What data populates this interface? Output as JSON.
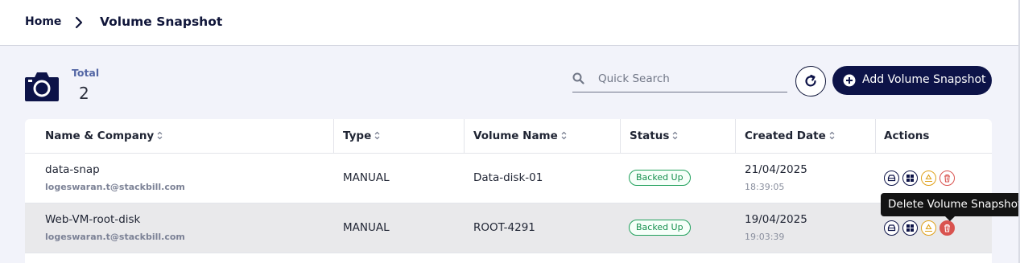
{
  "breadcrumb": {
    "home": "Home",
    "current": "Volume Snapshot"
  },
  "summary": {
    "label": "Total",
    "value": "2"
  },
  "search": {
    "placeholder": "Quick Search"
  },
  "actions": {
    "add_label": "Add Volume Snapshot"
  },
  "table": {
    "headers": [
      "Name & Company",
      "Type",
      "Volume Name",
      "Status",
      "Created Date",
      "Actions"
    ],
    "rows": [
      {
        "name": "data-snap",
        "email": "logeswaran.t@stackbill.com",
        "type": "MANUAL",
        "volume": "Data-disk-01",
        "status": "Backed Up",
        "date": "21/04/2025",
        "time": "18:39:05"
      },
      {
        "name": "Web-VM-root-disk",
        "email": "logeswaran.t@stackbill.com",
        "type": "MANUAL",
        "volume": "ROOT-4291",
        "status": "Backed Up",
        "date": "19/04/2025",
        "time": "19:03:39"
      }
    ]
  },
  "tooltip": "Delete Volume Snapshot",
  "colors": {
    "primary": "#0d1348",
    "status_green": "#17904f",
    "danger": "#d9534f",
    "warning": "#e0a017"
  }
}
